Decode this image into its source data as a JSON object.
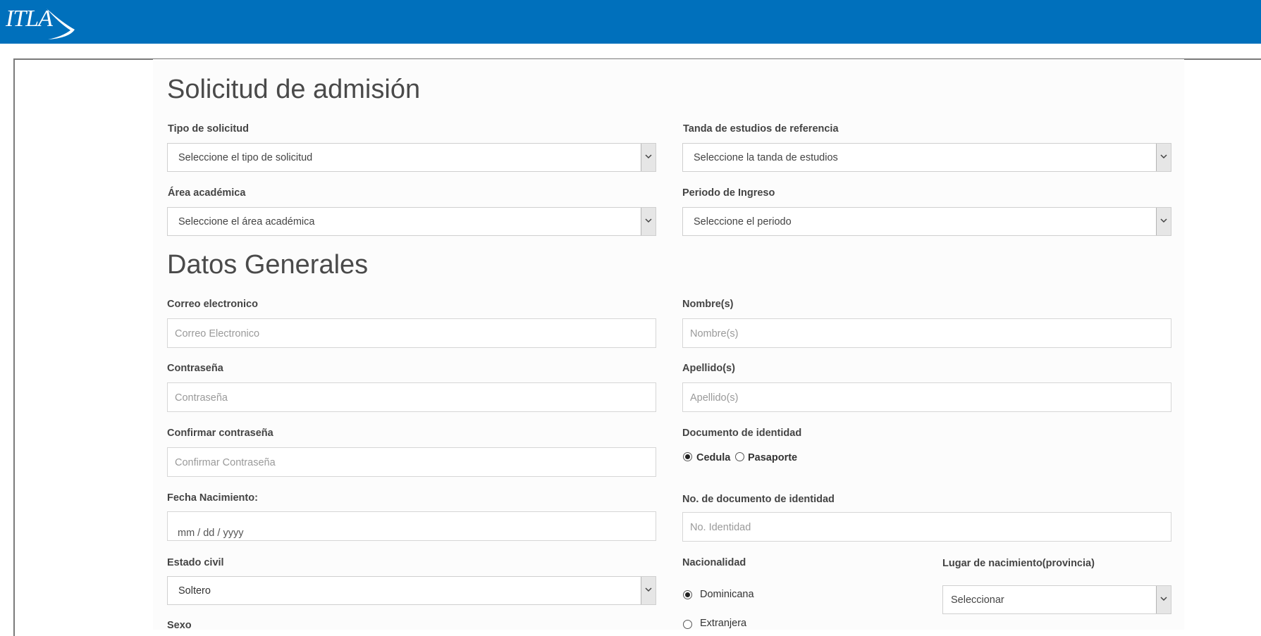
{
  "header": {
    "logo_text": "ITLA",
    "brand_color": "#0070bc"
  },
  "admission": {
    "title": "Solicitud de admisión",
    "tipo_solicitud": {
      "label": "Tipo de solicitud",
      "value": "Seleccione el tipo de solicitud"
    },
    "tanda": {
      "label": "Tanda de estudios de referencia",
      "value": "Seleccione la tanda de estudios"
    },
    "area": {
      "label": "Área académica",
      "value": "Seleccione el área académica"
    },
    "periodo": {
      "label": "Periodo de Ingreso",
      "value": "Seleccione el periodo"
    }
  },
  "general": {
    "title": "Datos Generales",
    "correo": {
      "label": "Correo electronico",
      "placeholder": "Correo Electronico"
    },
    "nombres": {
      "label": "Nombre(s)",
      "placeholder": "Nombre(s)"
    },
    "contrasena": {
      "label": "Contraseña",
      "placeholder": "Contraseña"
    },
    "apellidos": {
      "label": "Apellido(s)",
      "placeholder": "Apellido(s)"
    },
    "confirmar": {
      "label": "Confirmar contraseña",
      "placeholder": "Confirmar Contraseña"
    },
    "documento": {
      "label": "Documento de identidad",
      "option_cedula": "Cedula",
      "option_pasaporte": "Pasaporte",
      "selected": "Cedula"
    },
    "fecha": {
      "label": "Fecha Nacimiento:",
      "value": "mm / dd / yyyy"
    },
    "no_documento": {
      "label": "No. de documento de identidad",
      "placeholder": "No. Identidad"
    },
    "estado_civil": {
      "label": "Estado civil",
      "value": "Soltero"
    },
    "nacionalidad": {
      "label": "Nacionalidad",
      "option_dominicana": "Dominicana",
      "option_extranjera": "Extranjera",
      "selected": "Dominicana"
    },
    "lugar_nacimiento": {
      "label": "Lugar de nacimiento(provincia)",
      "value": "Seleccionar"
    },
    "sexo": {
      "label": "Sexo"
    }
  }
}
